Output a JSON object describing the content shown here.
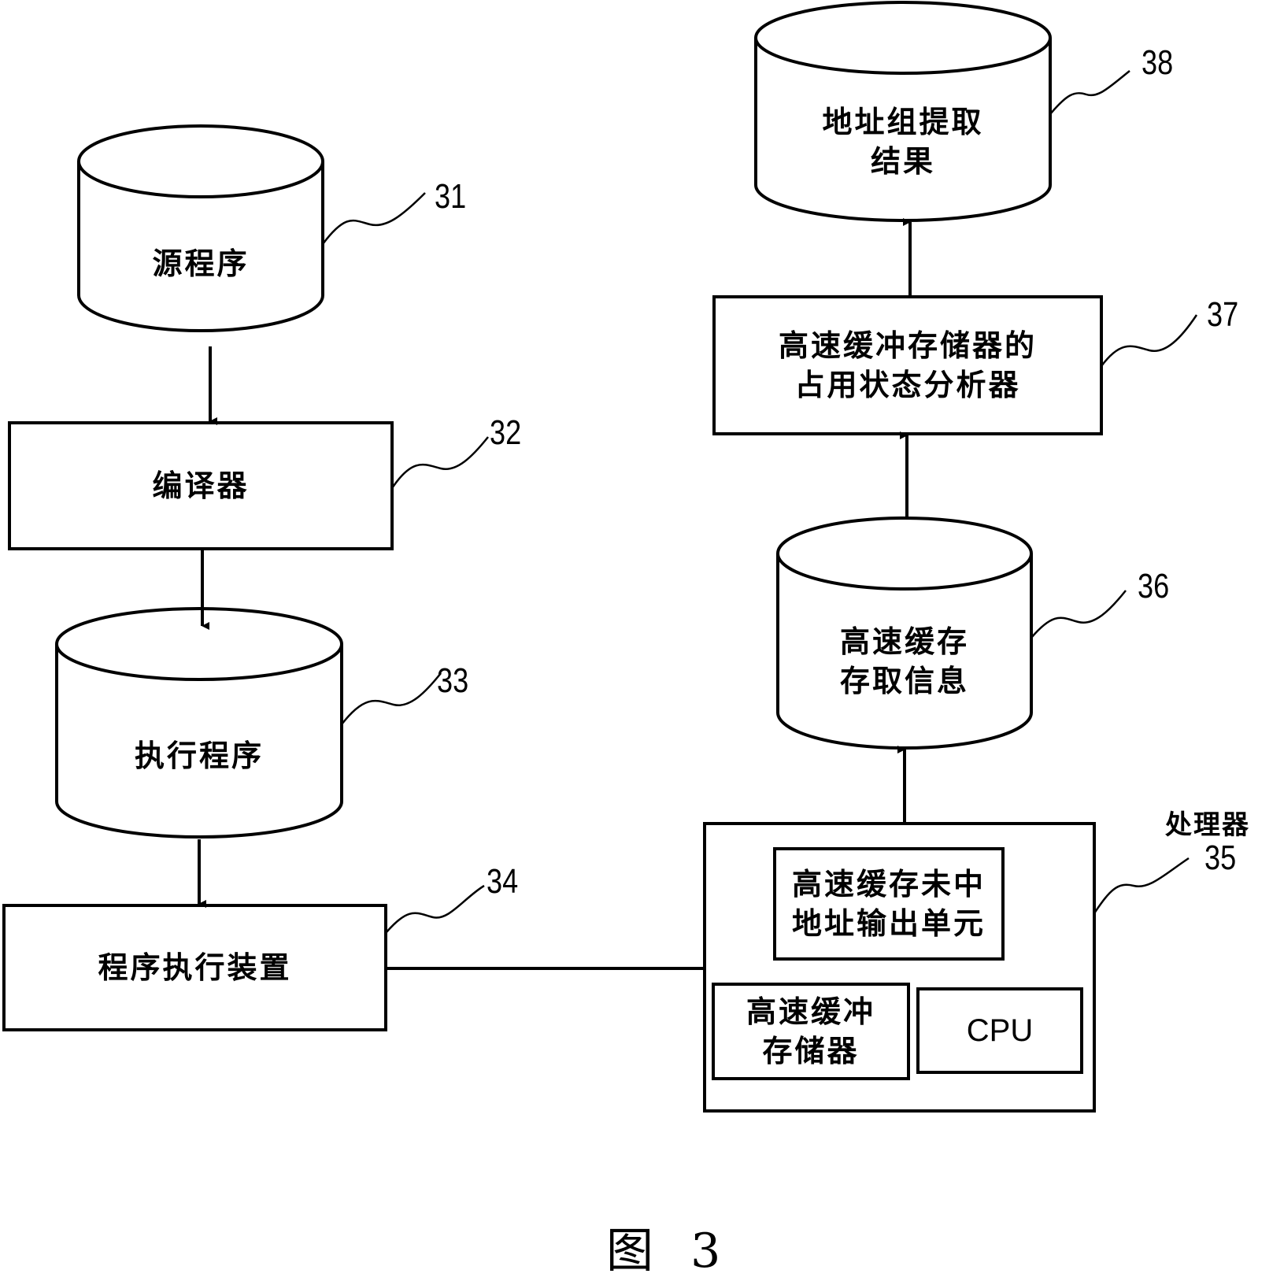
{
  "figure_caption": "图 3",
  "nodes": {
    "n31": {
      "label": "源程序",
      "ref": "31",
      "shape": "cylinder"
    },
    "n32": {
      "label": "编译器",
      "ref": "32",
      "shape": "box"
    },
    "n33": {
      "label": "执行程序",
      "ref": "33",
      "shape": "cylinder"
    },
    "n34": {
      "label": "程序执行装置",
      "ref": "34",
      "shape": "box"
    },
    "n35": {
      "label": "处理器",
      "ref": "35",
      "shape": "box",
      "children": {
        "miss_unit": "高速缓存未中\n地址输出单元",
        "cache": "高速缓冲\n存储器",
        "cpu": "CPU"
      }
    },
    "n36": {
      "label": "高速缓存\n存取信息",
      "ref": "36",
      "shape": "cylinder"
    },
    "n37": {
      "label": "高速缓冲存储器的\n占用状态分析器",
      "ref": "37",
      "shape": "box"
    },
    "n38": {
      "label": "地址组提取\n结果",
      "ref": "38",
      "shape": "cylinder"
    }
  },
  "edges": [
    {
      "from": "31",
      "to": "32",
      "arrow": true
    },
    {
      "from": "32",
      "to": "33",
      "arrow": true
    },
    {
      "from": "33",
      "to": "34",
      "arrow": true
    },
    {
      "from": "34",
      "to": "35",
      "arrow": false
    },
    {
      "from": "35",
      "to": "36",
      "arrow": true
    },
    {
      "from": "36",
      "to": "37",
      "arrow": true
    },
    {
      "from": "37",
      "to": "38",
      "arrow": true
    }
  ]
}
